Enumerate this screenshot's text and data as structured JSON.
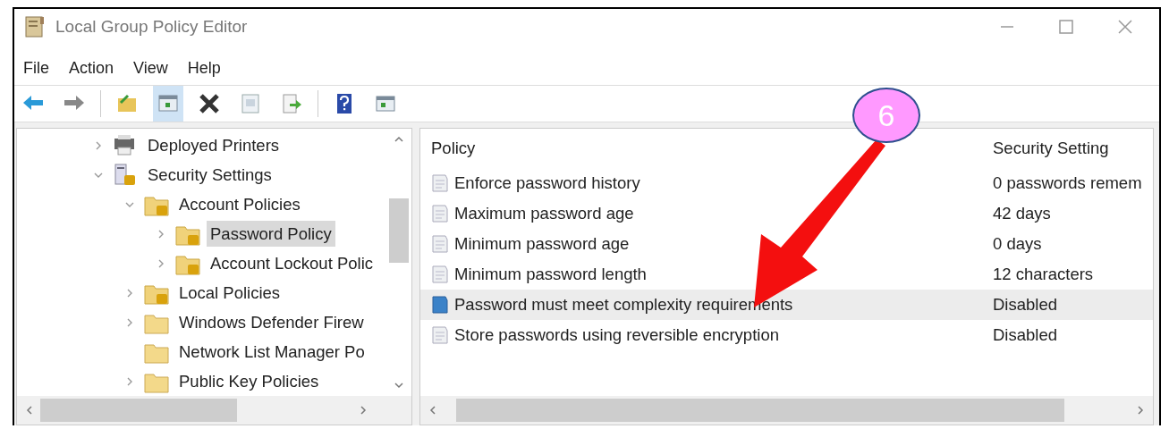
{
  "window": {
    "title": "Local Group Policy Editor"
  },
  "menu": [
    "File",
    "Action",
    "View",
    "Help"
  ],
  "toolbar": [
    {
      "kind": "back",
      "selected": false
    },
    {
      "kind": "forward",
      "selected": false
    },
    {
      "kind": "up",
      "selected": false
    },
    {
      "kind": "tree",
      "selected": true
    },
    {
      "kind": "delete",
      "selected": false
    },
    {
      "kind": "properties",
      "selected": false
    },
    {
      "kind": "export",
      "selected": false
    },
    {
      "kind": "help",
      "selected": false
    },
    {
      "kind": "pane",
      "selected": false
    }
  ],
  "tree": [
    {
      "label": "Deployed Printers",
      "kind": "printer",
      "expandable": true,
      "expanded": false,
      "selected": false
    },
    {
      "label": "Security Settings",
      "kind": "server",
      "expandable": true,
      "expanded": true,
      "selected": false,
      "children": [
        {
          "label": "Account Policies",
          "kind": "locked-folder",
          "expandable": true,
          "expanded": true,
          "selected": false,
          "children": [
            {
              "label": "Password Policy",
              "kind": "locked-folder",
              "expandable": true,
              "expanded": false,
              "selected": true
            },
            {
              "label": "Account Lockout Polic",
              "kind": "locked-folder",
              "expandable": true,
              "expanded": false,
              "selected": false
            }
          ]
        },
        {
          "label": "Local Policies",
          "kind": "locked-folder",
          "expandable": true,
          "expanded": false,
          "selected": false
        },
        {
          "label": "Windows Defender Firew",
          "kind": "folder",
          "expandable": true,
          "expanded": false,
          "selected": false
        },
        {
          "label": "Network List Manager Po",
          "kind": "folder",
          "expandable": false,
          "expanded": false,
          "selected": false
        },
        {
          "label": "Public Key Policies",
          "kind": "folder",
          "expandable": true,
          "expanded": false,
          "selected": false
        }
      ]
    }
  ],
  "table": {
    "columns": [
      "Policy",
      "Security Setting"
    ],
    "rows": [
      {
        "policy": "Enforce password history",
        "setting": "0 passwords remem",
        "selected": false
      },
      {
        "policy": "Maximum password age",
        "setting": "42 days",
        "selected": false
      },
      {
        "policy": "Minimum password age",
        "setting": "0 days",
        "selected": false
      },
      {
        "policy": "Minimum password length",
        "setting": "12 characters",
        "selected": false
      },
      {
        "policy": "Password must meet complexity requirements",
        "setting": "Disabled",
        "selected": true
      },
      {
        "policy": "Store passwords using reversible encryption",
        "setting": "Disabled",
        "selected": false
      }
    ]
  },
  "annotation": {
    "label": "6"
  }
}
